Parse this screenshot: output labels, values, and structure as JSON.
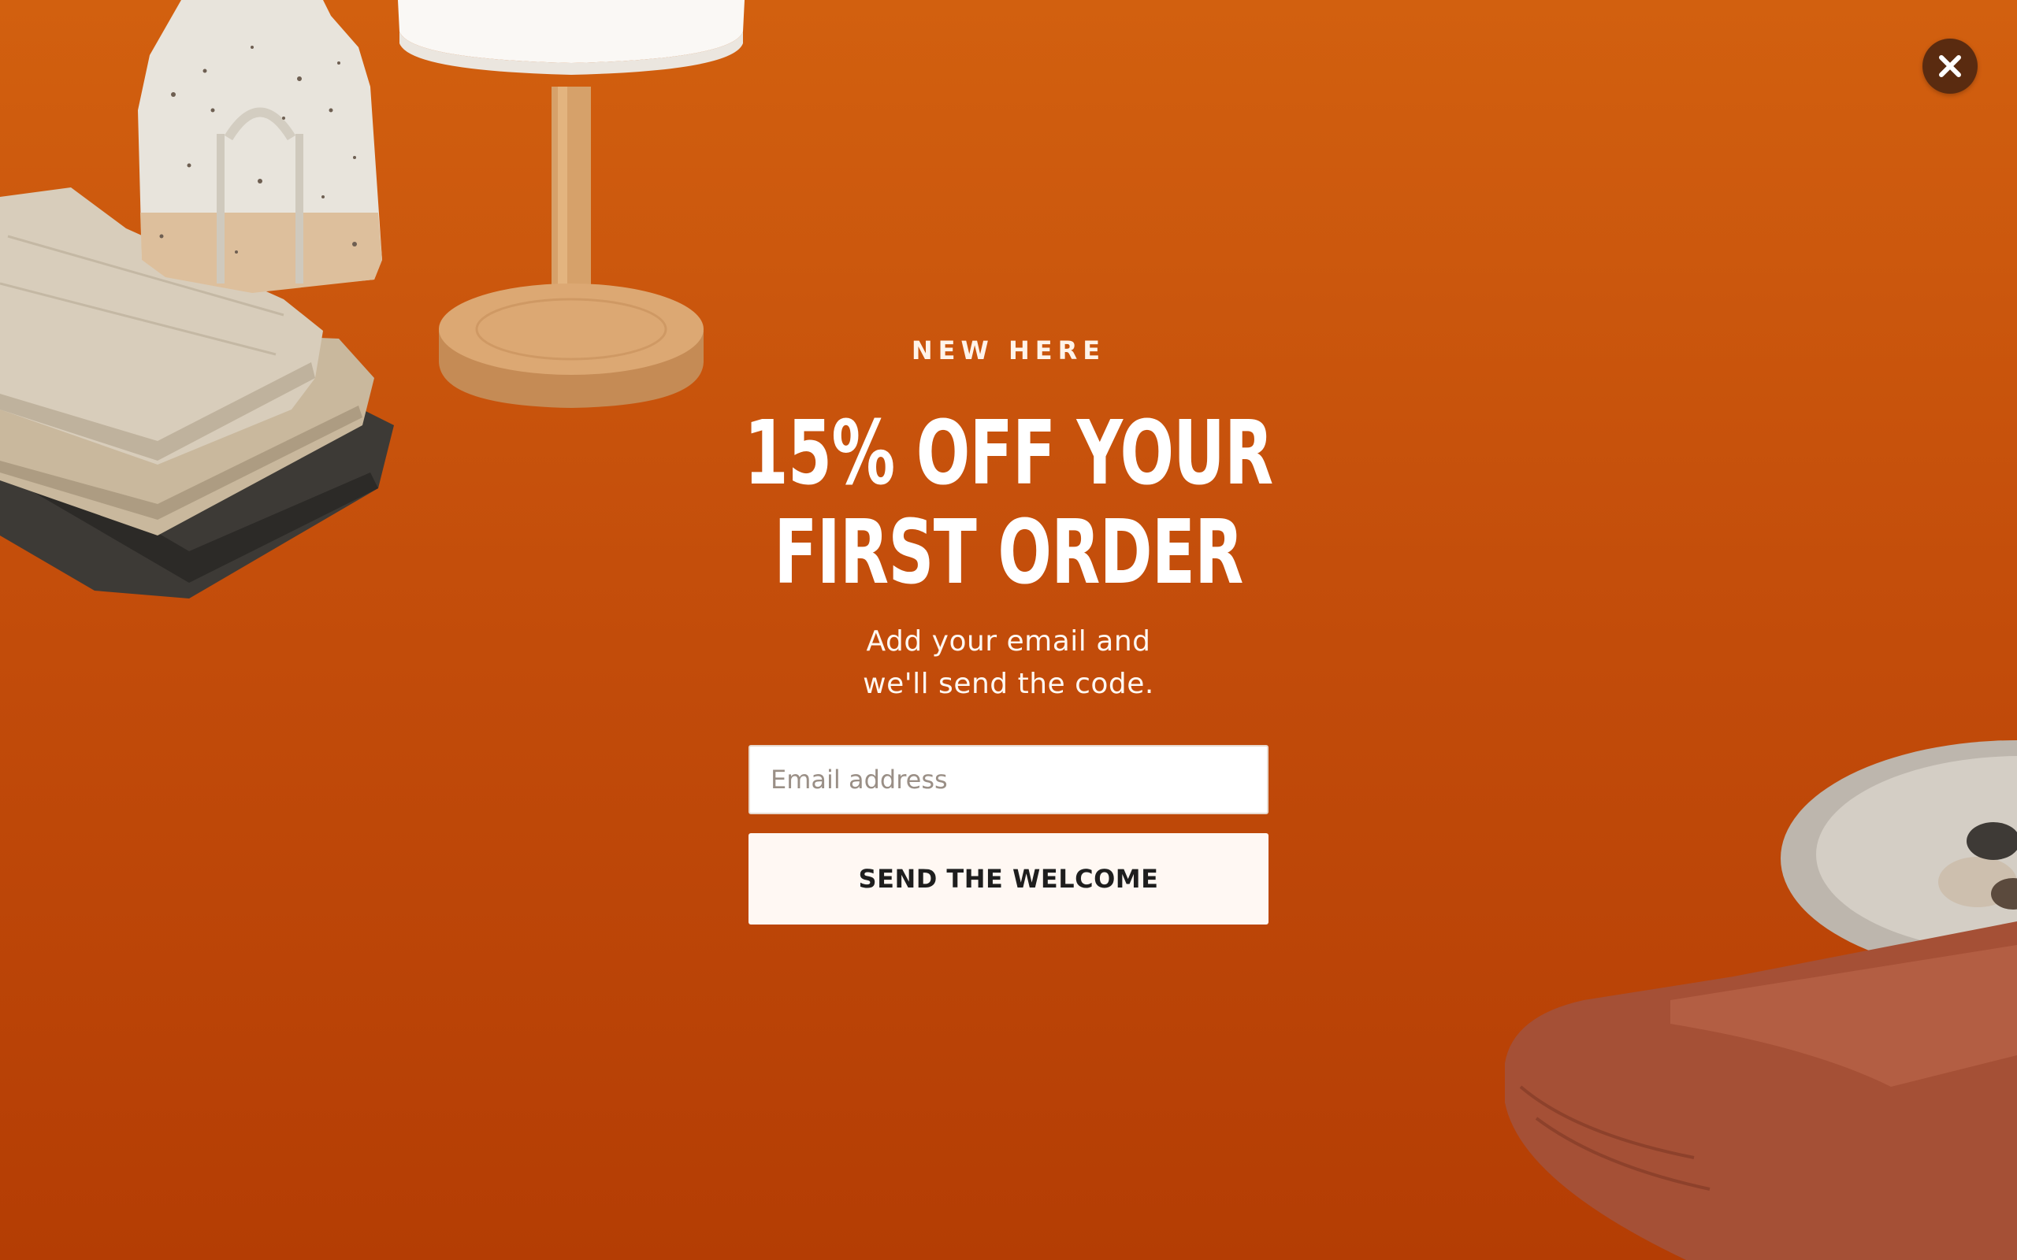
{
  "popup": {
    "eyebrow": "NEW HERE",
    "headline_line1": "15% OFF YOUR",
    "headline_line2": "FIRST ORDER",
    "subcopy_line1": "Add your email and",
    "subcopy_line2": "we'll send the code.",
    "email_placeholder": "Email address",
    "email_value": "",
    "submit_label": "SEND THE WELCOME",
    "close_icon": "close-icon"
  },
  "colors": {
    "background_top": "#d2600f",
    "background_bottom": "#b43d04",
    "close_button": "#5a2b10",
    "button_bg": "#fff8f3",
    "text_light": "#ffffff"
  },
  "decorations": [
    "ceramic-vase",
    "table-lamp",
    "folded-linen-napkins",
    "marble-tray-with-stones",
    "folded-rust-throw"
  ]
}
